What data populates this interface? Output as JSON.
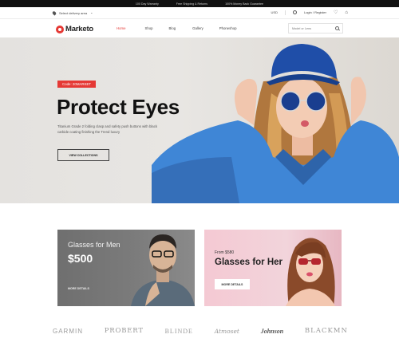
{
  "announcement": [
    "100 Day Warranty",
    "Free Shipping & Returns",
    "100% Money Back Guarantee"
  ],
  "util": {
    "delivery": "Select delivery area",
    "currency": "USD",
    "account": "Login / Register"
  },
  "logo": "Marketo",
  "menu": [
    "Home",
    "Shop",
    "Blog",
    "Gallery",
    "Phoneshop"
  ],
  "search": {
    "placeholder": "Model or Lens"
  },
  "hero": {
    "badge": "Code: 20MARKET",
    "title": "Protect Eyes",
    "desc": "Titanium Grade 2 folding clasp and safety push buttons with black carbide coating finishing the Trend luxury",
    "button": "VIEW COLLECTIONS"
  },
  "promo_men": {
    "title": "Glasses for Men",
    "price": "$500",
    "link": "MORE DETAILS"
  },
  "promo_her": {
    "from": "From $580",
    "title": "Glasses for Her",
    "button": "MORE DETAILS"
  },
  "brands": [
    "GARMIN",
    "PROBERT",
    "BLINDE",
    "Atmoset",
    "Johnson",
    "BLACKMN"
  ],
  "colors": {
    "accent": "#e53935",
    "topbar": "#111111",
    "hat": "#1f4ea8",
    "shirt": "#3f86d6",
    "pink_card": "#f2d4db"
  }
}
